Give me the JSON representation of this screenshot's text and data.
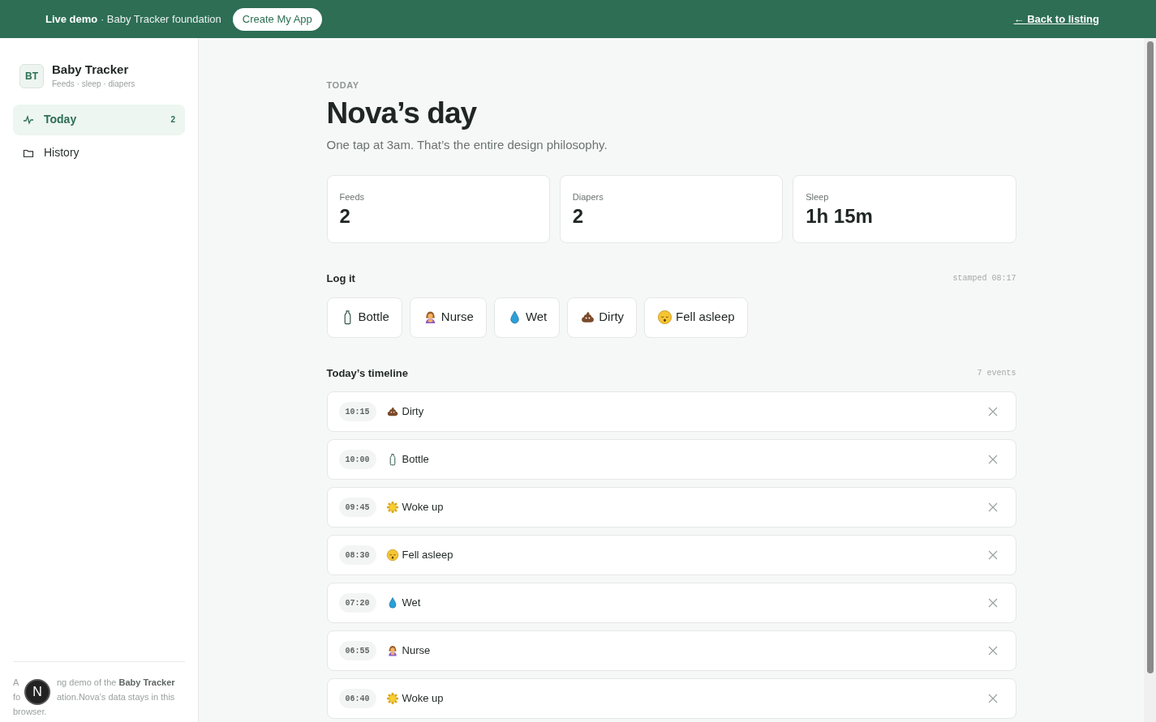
{
  "banner": {
    "label": "Live demo",
    "text": "· Baby Tracker foundation",
    "button": "Create My App",
    "back_link": "← Back to listing"
  },
  "app": {
    "logo": "BT",
    "name": "Baby Tracker",
    "tagline": "Feeds · sleep · diapers"
  },
  "sidebar": {
    "items": [
      {
        "label": "Today",
        "kind": "activity",
        "count": "2",
        "selected": true
      },
      {
        "label": "History",
        "kind": "folder",
        "selected": false
      }
    ],
    "footer_lines": [
      [
        "A",
        "ng demo of the **Baby Tracker**"
      ],
      [
        "fo",
        "ation.Nova’s data stays in this"
      ],
      [
        "browser."
      ]
    ],
    "avatar": "N"
  },
  "header": {
    "eyebrow": "TODAY",
    "title": "Nova’s day",
    "subtitle": "One tap at 3am. That’s the entire design philosophy."
  },
  "stats": [
    {
      "label": "Feeds",
      "value": "2"
    },
    {
      "label": "Diapers",
      "value": "2"
    },
    {
      "label": "Sleep",
      "value": "1h 15m"
    }
  ],
  "log": {
    "title": "Log it",
    "stamp": "stamped 08:17",
    "buttons": [
      {
        "label": "Bottle",
        "kind": "bottle"
      },
      {
        "label": "Nurse",
        "kind": "nurse"
      },
      {
        "label": "Wet",
        "kind": "wet"
      },
      {
        "label": "Dirty",
        "kind": "dirty"
      },
      {
        "label": "Fell asleep",
        "kind": "sleep"
      }
    ]
  },
  "timeline": {
    "title": "Today’s timeline",
    "count": "7 events",
    "events": [
      {
        "time": "10:15",
        "label": "Dirty",
        "kind": "dirty"
      },
      {
        "time": "10:00",
        "label": "Bottle",
        "kind": "bottle"
      },
      {
        "time": "09:45",
        "label": "Woke up",
        "kind": "wake"
      },
      {
        "time": "08:30",
        "label": "Fell asleep",
        "kind": "sleep"
      },
      {
        "time": "07:20",
        "label": "Wet",
        "kind": "wet"
      },
      {
        "time": "06:55",
        "label": "Nurse",
        "kind": "nurse"
      },
      {
        "time": "06:40",
        "label": "Woke up",
        "kind": "wake"
      }
    ]
  }
}
